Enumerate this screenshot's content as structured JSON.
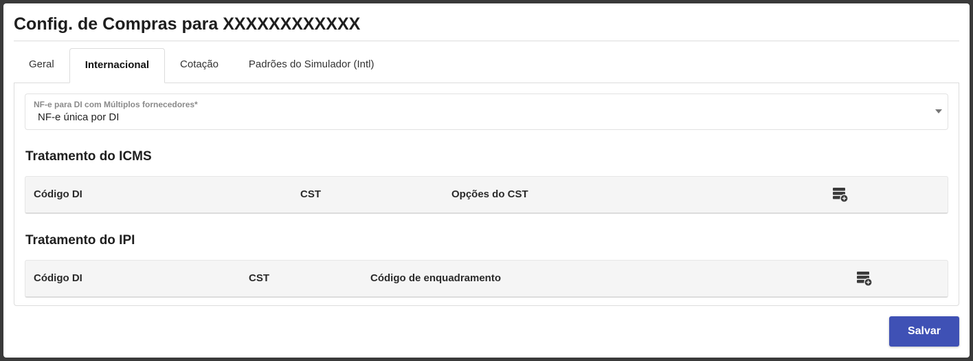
{
  "dialog": {
    "title": "Config. de Compras para XXXXXXXXXXXX"
  },
  "tabs": [
    {
      "label": "Geral",
      "active": false
    },
    {
      "label": "Internacional",
      "active": true
    },
    {
      "label": "Cotação",
      "active": false
    },
    {
      "label": "Padrões do Simulador (Intl)",
      "active": false
    }
  ],
  "nfe_select": {
    "label": "NF-e para DI com Múltiplos fornecedores*",
    "value": "NF-e única por DI",
    "icon": "chevron-down-icon"
  },
  "icms": {
    "title": "Tratamento do ICMS",
    "columns": [
      "Código DI",
      "CST",
      "Opções do CST"
    ],
    "add_icon": "add-row-icon"
  },
  "ipi": {
    "title": "Tratamento do IPI",
    "columns": [
      "Código DI",
      "CST",
      "Código de enquadramento"
    ],
    "add_icon": "add-row-icon"
  },
  "footer": {
    "save_label": "Salvar"
  },
  "colors": {
    "primary": "#3f51b5",
    "header_bg": "#f5f5f5",
    "border": "#dcdcdc"
  }
}
